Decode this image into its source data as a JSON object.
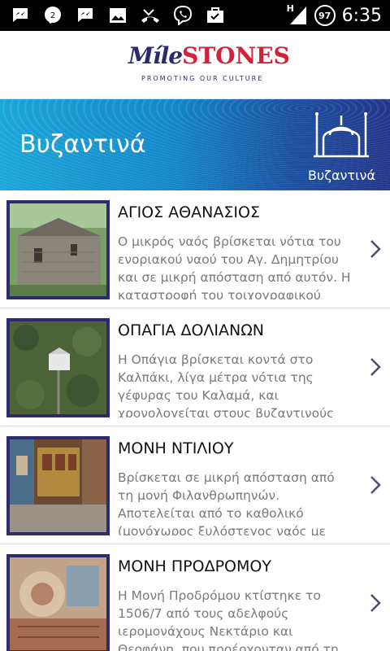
{
  "status_bar": {
    "time": "6:35",
    "battery": "97",
    "notification_icons": [
      "messenger-icon",
      "hangouts-icon",
      "messenger-icon",
      "gallery-icon",
      "missed-call-icon",
      "viber-icon",
      "briefcase-icon"
    ],
    "network": "H"
  },
  "header": {
    "logo_mile": "Míle",
    "logo_stones": "STONES",
    "logo_tagline": "PROMOTING OUR CULTURE"
  },
  "banner": {
    "title": "Βυζαντινά",
    "icon_caption": "Βυζαντινά",
    "icon": "byzantine-church-icon"
  },
  "items": [
    {
      "title": "ΑΓΙΟΣ ΑΘΑΝΑΣΙΟΣ",
      "description": "Ο μικρός ναός βρίσκεται νότια του ενοριακού ναού του Αγ. Δημητρίου και σε μικρή απόσταση από αυτόν. Η καταστροφή του τοιχογραφικού διακόσμου του..."
    },
    {
      "title": "ΟΠΑΓΙΑ ΔΟΛΙΑΝΩΝ",
      "description": "Η Οπάγια βρίσκεται κοντά στο Καλπάκι, λίγα μέτρα νότια της γέφυρας του Καλαμά, και χρονολογείται στους βυζαντινούς χρόνους..."
    },
    {
      "title": "ΜΟΝΗ ΝΤΙΛΙΟΥ",
      "description": "Βρίσκεται σε μικρή απόσταση από τη μονή Φιλανθρωπηνών. Αποτελείται από το καθολικό (μονόχωρος ξυλόστεγος ναός με τρούλο)..."
    },
    {
      "title": "ΜΟΝΗ ΠΡΟΔΡΟΜΟΥ",
      "description": "Η Μονή Προδρόμου κτίστηκε το 1506/7 από τους αδελφούς ιερομονάχους Νεκτάριο και Θεοφάνη, που προέρχονταν από τη..."
    }
  ]
}
